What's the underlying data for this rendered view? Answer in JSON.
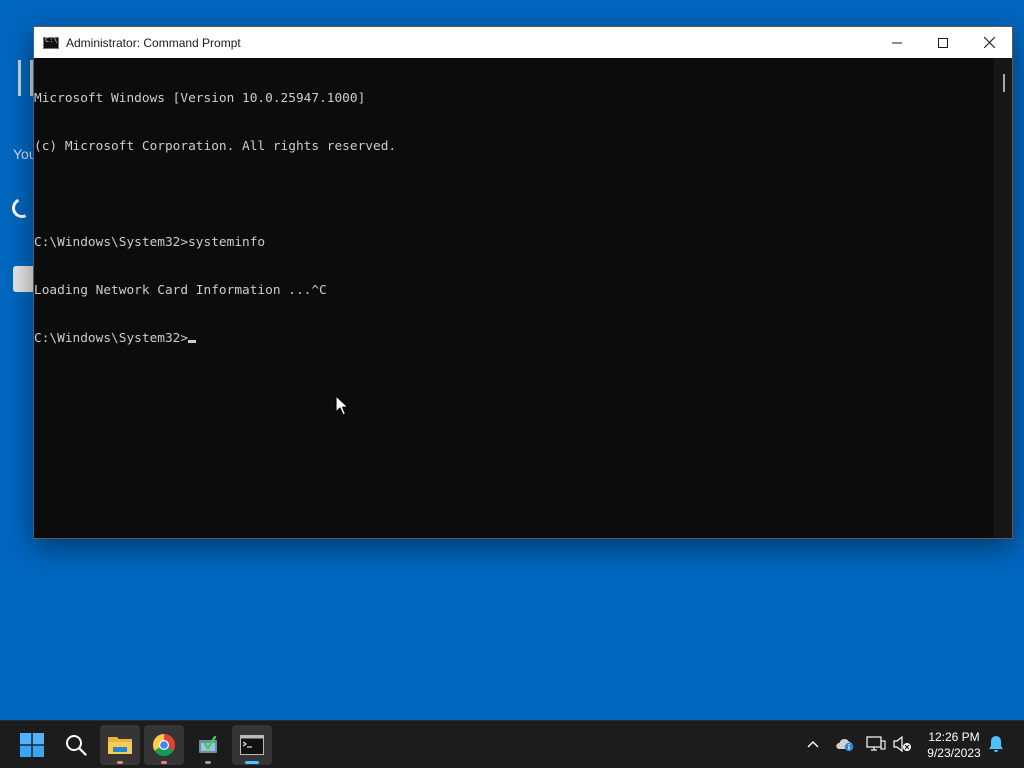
{
  "window": {
    "title": "Administrator: Command Prompt"
  },
  "console": {
    "lines": [
      "Microsoft Windows [Version 10.0.25947.1000]",
      "(c) Microsoft Corporation. All rights reserved.",
      "",
      "C:\\Windows\\System32>systeminfo",
      "Loading Network Card Information ...^C",
      "C:\\Windows\\System32>"
    ]
  },
  "background_app": {
    "partial_text": "You"
  },
  "taskbar": {
    "items": [
      {
        "name": "start",
        "icon": "windows-logo-icon"
      },
      {
        "name": "search",
        "icon": "search-icon"
      },
      {
        "name": "file-explorer",
        "icon": "folder-icon"
      },
      {
        "name": "chrome",
        "icon": "chrome-icon"
      },
      {
        "name": "app",
        "icon": "app-icon"
      },
      {
        "name": "command-prompt",
        "icon": "terminal-icon"
      }
    ],
    "clock": {
      "time": "12:26 PM",
      "date": "9/23/2023"
    }
  },
  "colors": {
    "desktop": "#0067c0",
    "console_bg": "#0c0c0c",
    "console_fg": "#cccccc",
    "taskbar": "#1c1c1c",
    "accent": "#4cc2ff"
  }
}
